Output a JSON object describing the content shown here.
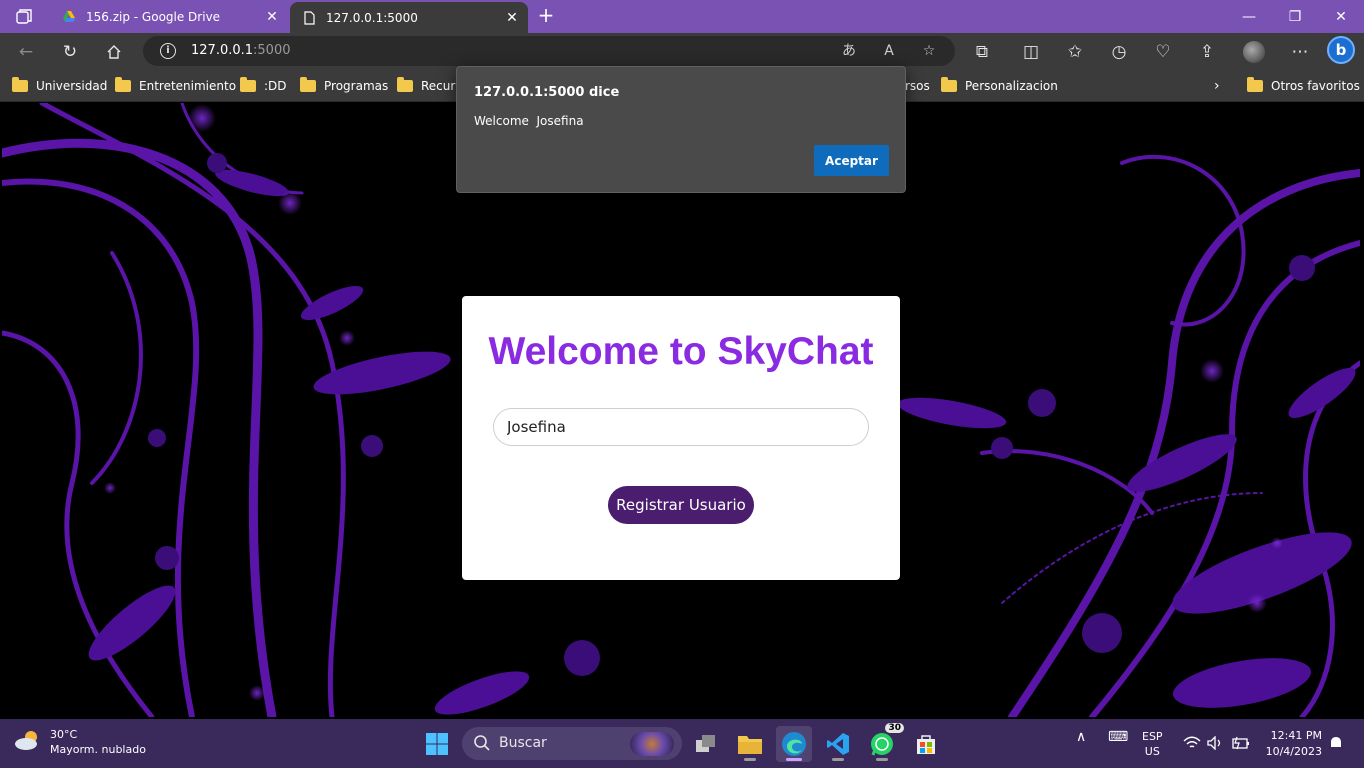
{
  "browser": {
    "tabs": [
      {
        "title": "156.zip - Google Drive",
        "active": false
      },
      {
        "title": "127.0.0.1:5000",
        "active": true
      }
    ],
    "address": {
      "host": "127.0.0.1",
      "port": ":5000"
    },
    "bookmarks": [
      "Universidad",
      "Entretenimiento",
      ":DD",
      "Programas",
      "Recurs",
      "rsos",
      "Personalizacion"
    ],
    "other_favorites": "Otros favoritos"
  },
  "dialog": {
    "title": "127.0.0.1:5000 dice",
    "message": "Welcome  Josefina",
    "ok_label": "Aceptar"
  },
  "page": {
    "title": "Welcome to SkyChat",
    "name_value": "Josefina",
    "register_label": "Registrar Usuario"
  },
  "taskbar": {
    "weather_temp": "30°C",
    "weather_desc": "Mayorm. nublado",
    "search_label": "Buscar",
    "whatsapp_badge": "30",
    "lang_line1": "ESP",
    "lang_line2": "US",
    "time": "12:41 PM",
    "date": "10/4/2023"
  },
  "colors": {
    "accent_purple": "#8a2be2",
    "button_purple": "#4b1d6e",
    "dialog_button": "#0f6cbd",
    "tabbar": "#7a52b3"
  }
}
